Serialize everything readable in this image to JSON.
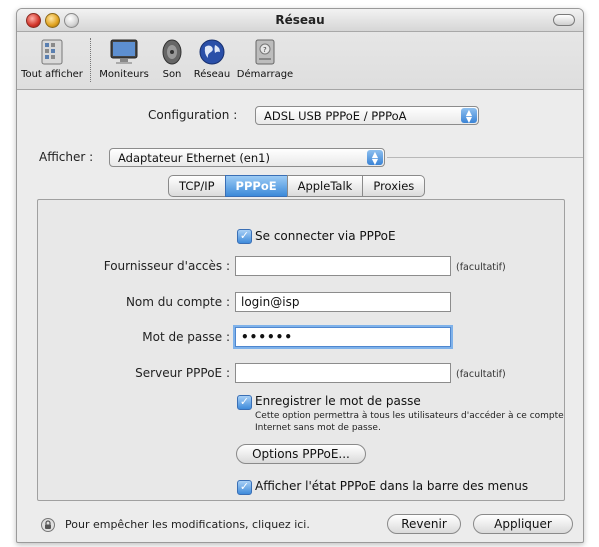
{
  "window": {
    "title": "Réseau"
  },
  "toolbar": {
    "items": [
      {
        "label": "Tout afficher",
        "icon": "show-all-icon"
      },
      {
        "label": "Moniteurs",
        "icon": "monitor-icon"
      },
      {
        "label": "Son",
        "icon": "speaker-icon"
      },
      {
        "label": "Réseau",
        "icon": "globe-icon"
      },
      {
        "label": "Démarrage",
        "icon": "disk-icon"
      }
    ]
  },
  "configuration": {
    "label": "Configuration :",
    "value": "ADSL USB PPPoE / PPPoA"
  },
  "afficher": {
    "label": "Afficher :",
    "value": "Adaptateur Ethernet (en1)"
  },
  "tabs": [
    {
      "label": "TCP/IP",
      "active": false
    },
    {
      "label": "PPPoE",
      "active": true
    },
    {
      "label": "AppleTalk",
      "active": false
    },
    {
      "label": "Proxies",
      "active": false
    }
  ],
  "pppoe": {
    "connect_checkbox": {
      "label": "Se connecter via PPPoE",
      "checked": true
    },
    "provider": {
      "label": "Fournisseur d'accès :",
      "value": "",
      "hint": "(facultatif)"
    },
    "account": {
      "label": "Nom du compte :",
      "value": "login@isp"
    },
    "password": {
      "label": "Mot de passe :",
      "value": "••••••"
    },
    "server": {
      "label": "Serveur PPPoE :",
      "value": "",
      "hint": "(facultatif)"
    },
    "save_password": {
      "label": "Enregistrer le mot de passe",
      "checked": true,
      "note": "Cette option permettra à tous les utilisateurs d'accéder à ce compte Internet sans mot de passe."
    },
    "options_button": "Options PPPoE...",
    "show_status": {
      "label": "Afficher l'état PPPoE dans la barre des menus",
      "checked": true
    }
  },
  "footer": {
    "lock_text": "Pour empêcher les modifications, cliquez ici.",
    "revert_button": "Revenir",
    "apply_button": "Appliquer"
  },
  "colors": {
    "accent": "#3d8ad9",
    "window_bg": "#ececec"
  }
}
